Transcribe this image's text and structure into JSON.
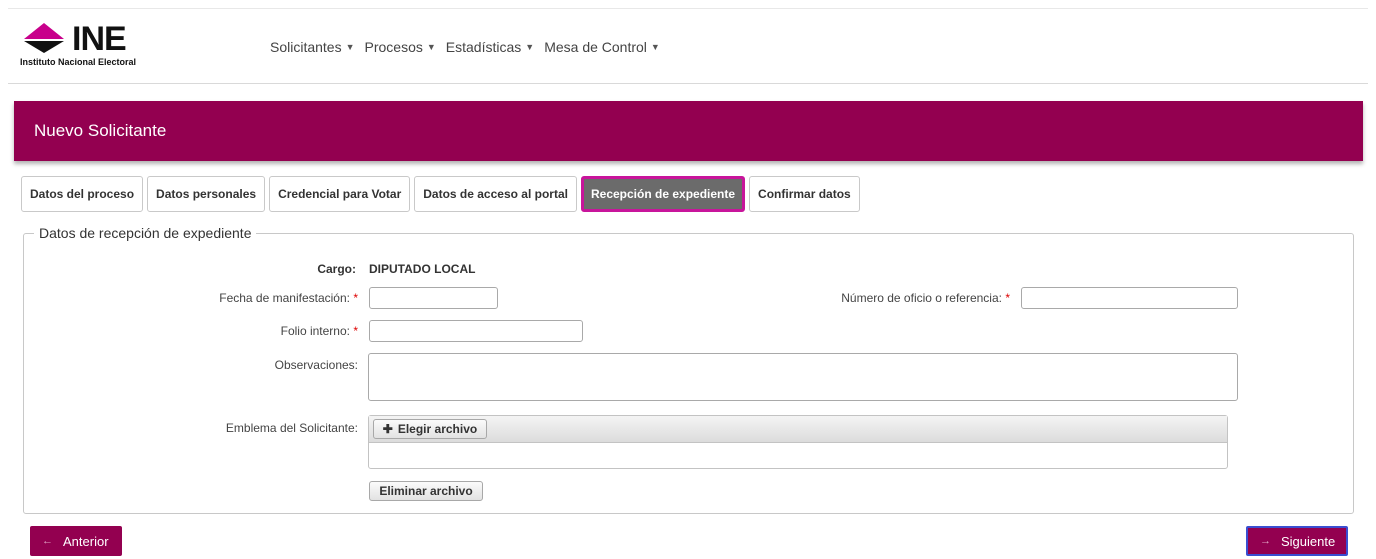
{
  "brand": {
    "name": "INE",
    "subtitle": "Instituto Nacional Electoral",
    "color": "#930050"
  },
  "nav": {
    "items": [
      {
        "label": "Solicitantes"
      },
      {
        "label": "Procesos"
      },
      {
        "label": "Estadísticas"
      },
      {
        "label": "Mesa de Control"
      }
    ]
  },
  "page": {
    "title": "Nuevo Solicitante"
  },
  "tabs": [
    {
      "label": "Datos del proceso"
    },
    {
      "label": "Datos personales"
    },
    {
      "label": "Credencial para Votar"
    },
    {
      "label": "Datos de acceso al portal"
    },
    {
      "label": "Recepción de expediente",
      "active": true
    },
    {
      "label": "Confirmar datos"
    }
  ],
  "form": {
    "legend": "Datos de recepción de expediente",
    "cargo_label": "Cargo:",
    "cargo_value": "DIPUTADO LOCAL",
    "fecha_label": "Fecha de manifestación:",
    "fecha_value": "",
    "numero_label": "Número de oficio o referencia:",
    "numero_value": "",
    "folio_label": "Folio interno:",
    "folio_value": "",
    "observaciones_label": "Observaciones:",
    "observaciones_value": "",
    "emblema_label": "Emblema del Solicitante:",
    "elegir_label": "Elegir archivo",
    "eliminar_label": "Eliminar archivo",
    "required_mark": "*"
  },
  "footer": {
    "prev_label": "Anterior",
    "next_label": "Siguiente"
  }
}
